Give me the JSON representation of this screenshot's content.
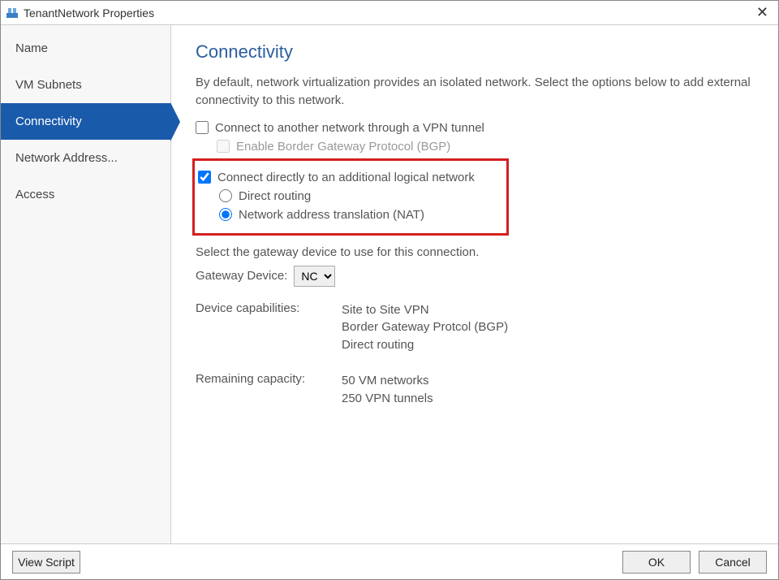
{
  "window": {
    "title": "TenantNetwork Properties"
  },
  "sidebar": {
    "items": [
      {
        "label": "Name"
      },
      {
        "label": "VM Subnets"
      },
      {
        "label": "Connectivity"
      },
      {
        "label": "Network Address..."
      },
      {
        "label": "Access"
      }
    ],
    "selected_index": 2
  },
  "content": {
    "heading": "Connectivity",
    "intro": "By default, network virtualization provides an isolated network. Select the options below to add external connectivity to this network.",
    "vpn_tunnel_label": "Connect to another network through a VPN tunnel",
    "vpn_tunnel_checked": false,
    "bgp_label": "Enable Border Gateway Protocol (BGP)",
    "bgp_checked": false,
    "bgp_disabled": true,
    "direct_connect_label": "Connect directly to an additional logical network",
    "direct_connect_checked": true,
    "direct_routing_label": "Direct routing",
    "direct_routing_selected": false,
    "nat_label": "Network address translation (NAT)",
    "nat_selected": true,
    "gateway_prompt": "Select the gateway device to use for this connection.",
    "gateway_label": "Gateway Device:",
    "gateway_selected": "NC",
    "gateway_options": [
      "NC"
    ],
    "caps_label": "Device capabilities:",
    "caps_values": [
      "Site to Site VPN",
      "Border Gateway Protcol (BGP)",
      "Direct routing"
    ],
    "remaining_label": "Remaining capacity:",
    "remaining_values": [
      "50 VM networks",
      "250 VPN tunnels"
    ]
  },
  "footer": {
    "view_script": "View Script",
    "ok": "OK",
    "cancel": "Cancel"
  }
}
